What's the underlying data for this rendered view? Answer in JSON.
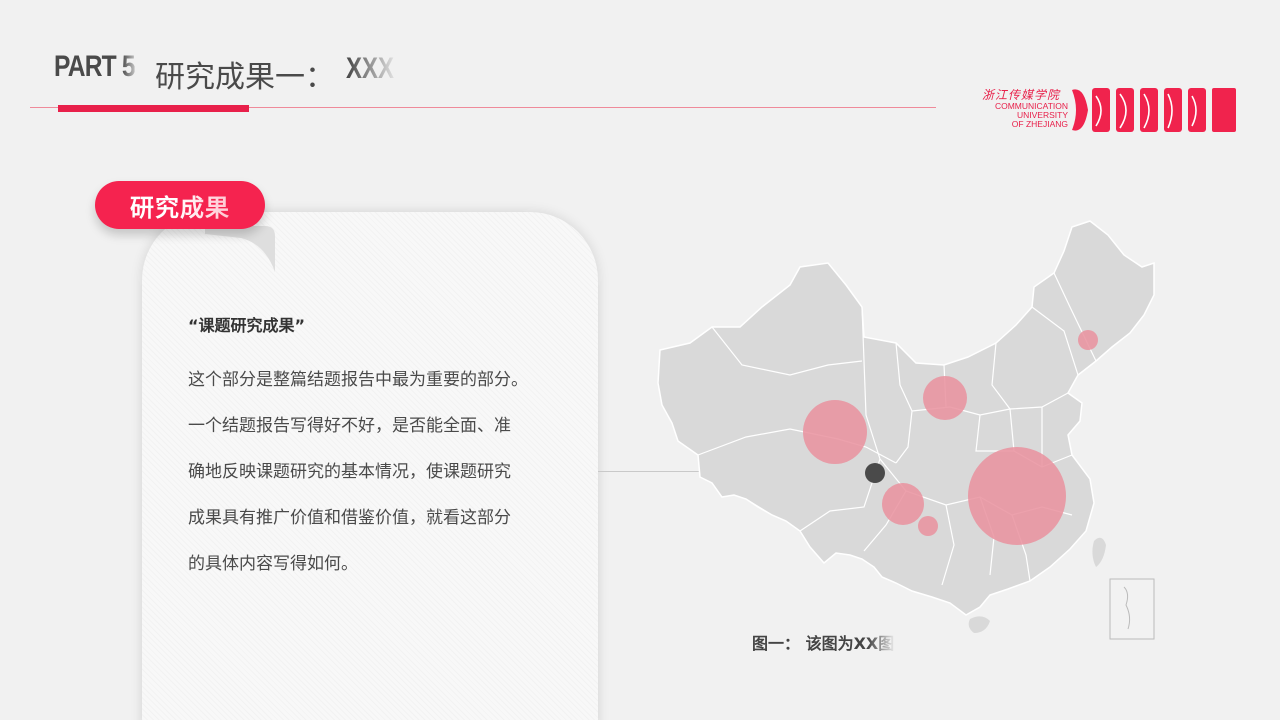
{
  "header": {
    "part_prefix": "PART",
    "part_number": "5",
    "title": "研究成果一：",
    "title_suffix": "XXX"
  },
  "logo": {
    "cn_name": "浙江传媒学院",
    "en_name": "COMMUNICATION\nUNIVERSITY\nOF ZHEJIANG"
  },
  "tag": {
    "label": "研究成果"
  },
  "card": {
    "heading": "“课题研究成果”",
    "lines": [
      "这个部分是整篇结题报告中最为重要的部分。",
      "一个结题报告写得好不好，是否能全面、准",
      "确地反映课题研究的基本情况，使课题研究",
      "成果具有推广价值和借鉴价值，就看这部分",
      "的具体内容写得如何。"
    ]
  },
  "map": {
    "caption_label": "图一：",
    "caption_text": "该图为XX图"
  },
  "colors": {
    "accent": "#e8204a",
    "tag": "#f5234f",
    "bubble": "#e9909e",
    "map_fill": "#d9d9d9",
    "background": "#f1f1f1",
    "text": "#4a4a4a"
  }
}
